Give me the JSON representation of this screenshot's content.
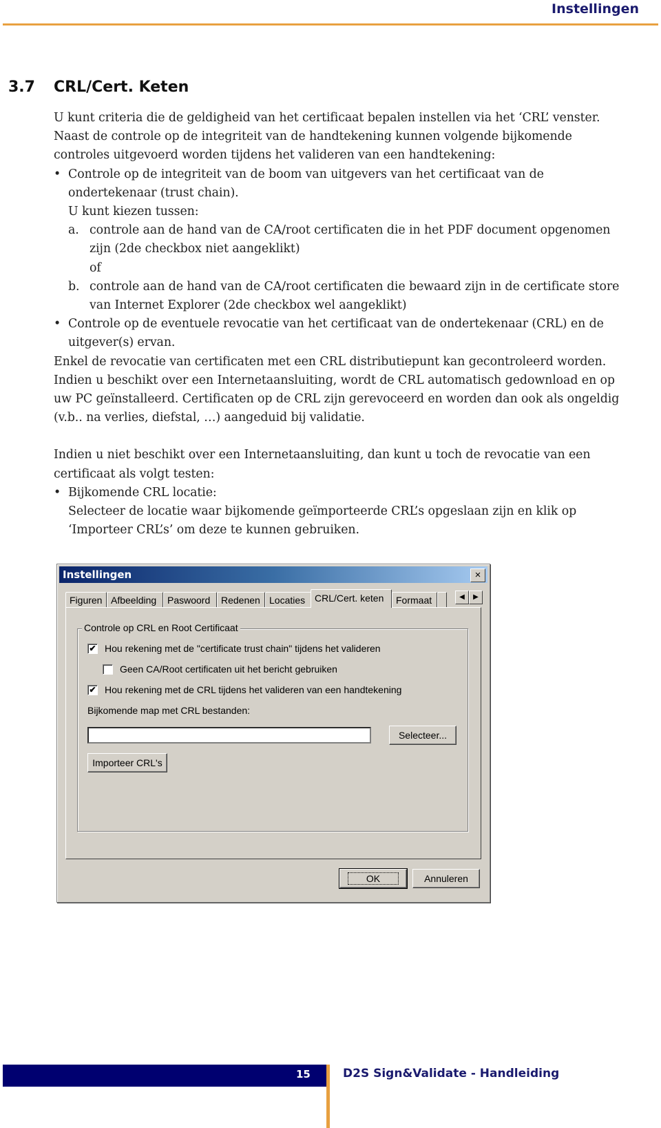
{
  "header": {
    "title": "Instellingen"
  },
  "section": {
    "number": "3.7",
    "title": "CRL/Cert. Keten"
  },
  "body": {
    "intro_1": "U kunt criteria die de geldigheid van het certificaat bepalen instellen via het ‘CRL’ venster.",
    "intro_2": "Naast de controle op de integriteit van de handtekening kunnen volgende bijkomende",
    "intro_3": "controles uitgevoerd worden tijdens het valideren van een handtekening:",
    "bullet_1_line_1": "Controle op de integriteit van de boom van uitgevers van het certificaat van de",
    "bullet_1_line_2": "ondertekenaar (trust chain).",
    "choose": "U kunt kiezen tussen:",
    "option_a_label": "a.",
    "option_a_line_1": "controle aan de hand van de CA/root certificaten die in het PDF document opgenomen",
    "option_a_line_2": "zijn (2de checkbox niet aangeklikt)",
    "or": "of",
    "option_b_label": "b.",
    "option_b_line_1": "controle aan de hand van de CA/root certificaten die bewaard zijn in de certificate store",
    "option_b_line_2": "van Internet Explorer (2de checkbox wel aangeklikt)",
    "bullet_2_line_1": "Controle op de eventuele revocatie van het certificaat van de ondertekenaar (CRL) en de",
    "bullet_2_line_2": "uitgever(s) ervan.",
    "para_1": "Enkel de revocatie van certificaten met een CRL distributiepunt kan gecontroleerd worden.",
    "para_2": "Indien u beschikt over een Internetaansluiting, wordt de CRL automatisch gedownload en op",
    "para_3": "uw PC geïnstalleerd. Certificaten op de CRL zijn gerevoceerd en worden dan ook als ongeldig",
    "para_4": "(v.b.. na verlies, diefstal, …) aangeduid bij validatie.",
    "para_5": "Indien u niet beschikt over een Internetaansluiting, dan kunt u toch de revocatie van een",
    "para_6": "certificaat als volgt testen:",
    "bullet_3": "Bijkomende CRL locatie:",
    "bullet_3_line_2": "Selecteer de locatie waar bijkomende geïmporteerde CRL’s opgeslaan zijn en klik op",
    "bullet_3_line_3": "‘Importeer CRL’s’ om deze te kunnen gebruiken."
  },
  "dialog": {
    "title": "Instellingen",
    "close_icon": "×",
    "tabs": [
      {
        "label": "Figuren",
        "active": false
      },
      {
        "label": "Afbeelding",
        "active": false
      },
      {
        "label": "Paswoord",
        "active": false
      },
      {
        "label": "Redenen",
        "active": false
      },
      {
        "label": "Locaties",
        "active": false
      },
      {
        "label": "CRL/Cert. keten",
        "active": true
      },
      {
        "label": "Formaat",
        "active": false
      }
    ],
    "tab_scroll_left": "◀",
    "tab_scroll_right": "▶",
    "group_label": "Controle op CRL en Root Certificaat",
    "checkboxes": [
      {
        "label": "Hou rekening met de \"certificate trust chain\" tijdens het valideren",
        "checked": true,
        "mark": "✔"
      },
      {
        "label": "Geen CA/Root certificaten uit het bericht gebruiken",
        "checked": false,
        "mark": ""
      },
      {
        "label": "Hou rekening met de CRL tijdens het valideren van een handtekening",
        "checked": true,
        "mark": "✔"
      }
    ],
    "map_label": "Bijkomende map met CRL bestanden:",
    "map_value": "",
    "select_button": "Selecteer...",
    "import_button": "Importeer CRL's",
    "ok_button": "OK",
    "cancel_button": "Annuleren"
  },
  "footer": {
    "page_number": "15",
    "title": "D2S Sign&Validate - Handleiding"
  },
  "colors": {
    "brand_navy": "#000070",
    "accent_orange": "#e8a040",
    "title_blue": "#1a1a6e"
  }
}
